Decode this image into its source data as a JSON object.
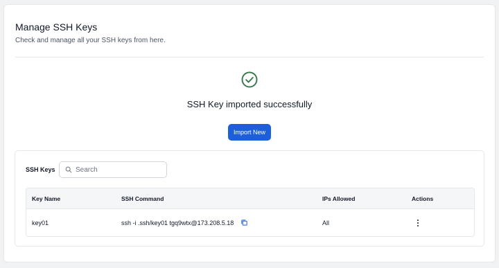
{
  "header": {
    "title": "Manage SSH Keys",
    "subtitle": "Check and manage all your SSH keys from here."
  },
  "status": {
    "icon": "check-circle-icon",
    "message": "SSH Key imported successfully",
    "color": "#3f7a52"
  },
  "import_button": {
    "label": "Import New",
    "color": "#1d5fd9"
  },
  "keys_section": {
    "label": "SSH Keys",
    "search": {
      "placeholder": "Search",
      "value": ""
    }
  },
  "table": {
    "columns": [
      "Key Name",
      "SSH Command",
      "IPs Allowed",
      "Actions"
    ],
    "rows": [
      {
        "key_name": "key01",
        "ssh_command": "ssh -i .ssh/key01 tgq9wtx@173.208.5.18",
        "ips_allowed": "All",
        "copy_icon": "copy-icon",
        "actions_icon": "more-vertical-icon"
      }
    ]
  }
}
